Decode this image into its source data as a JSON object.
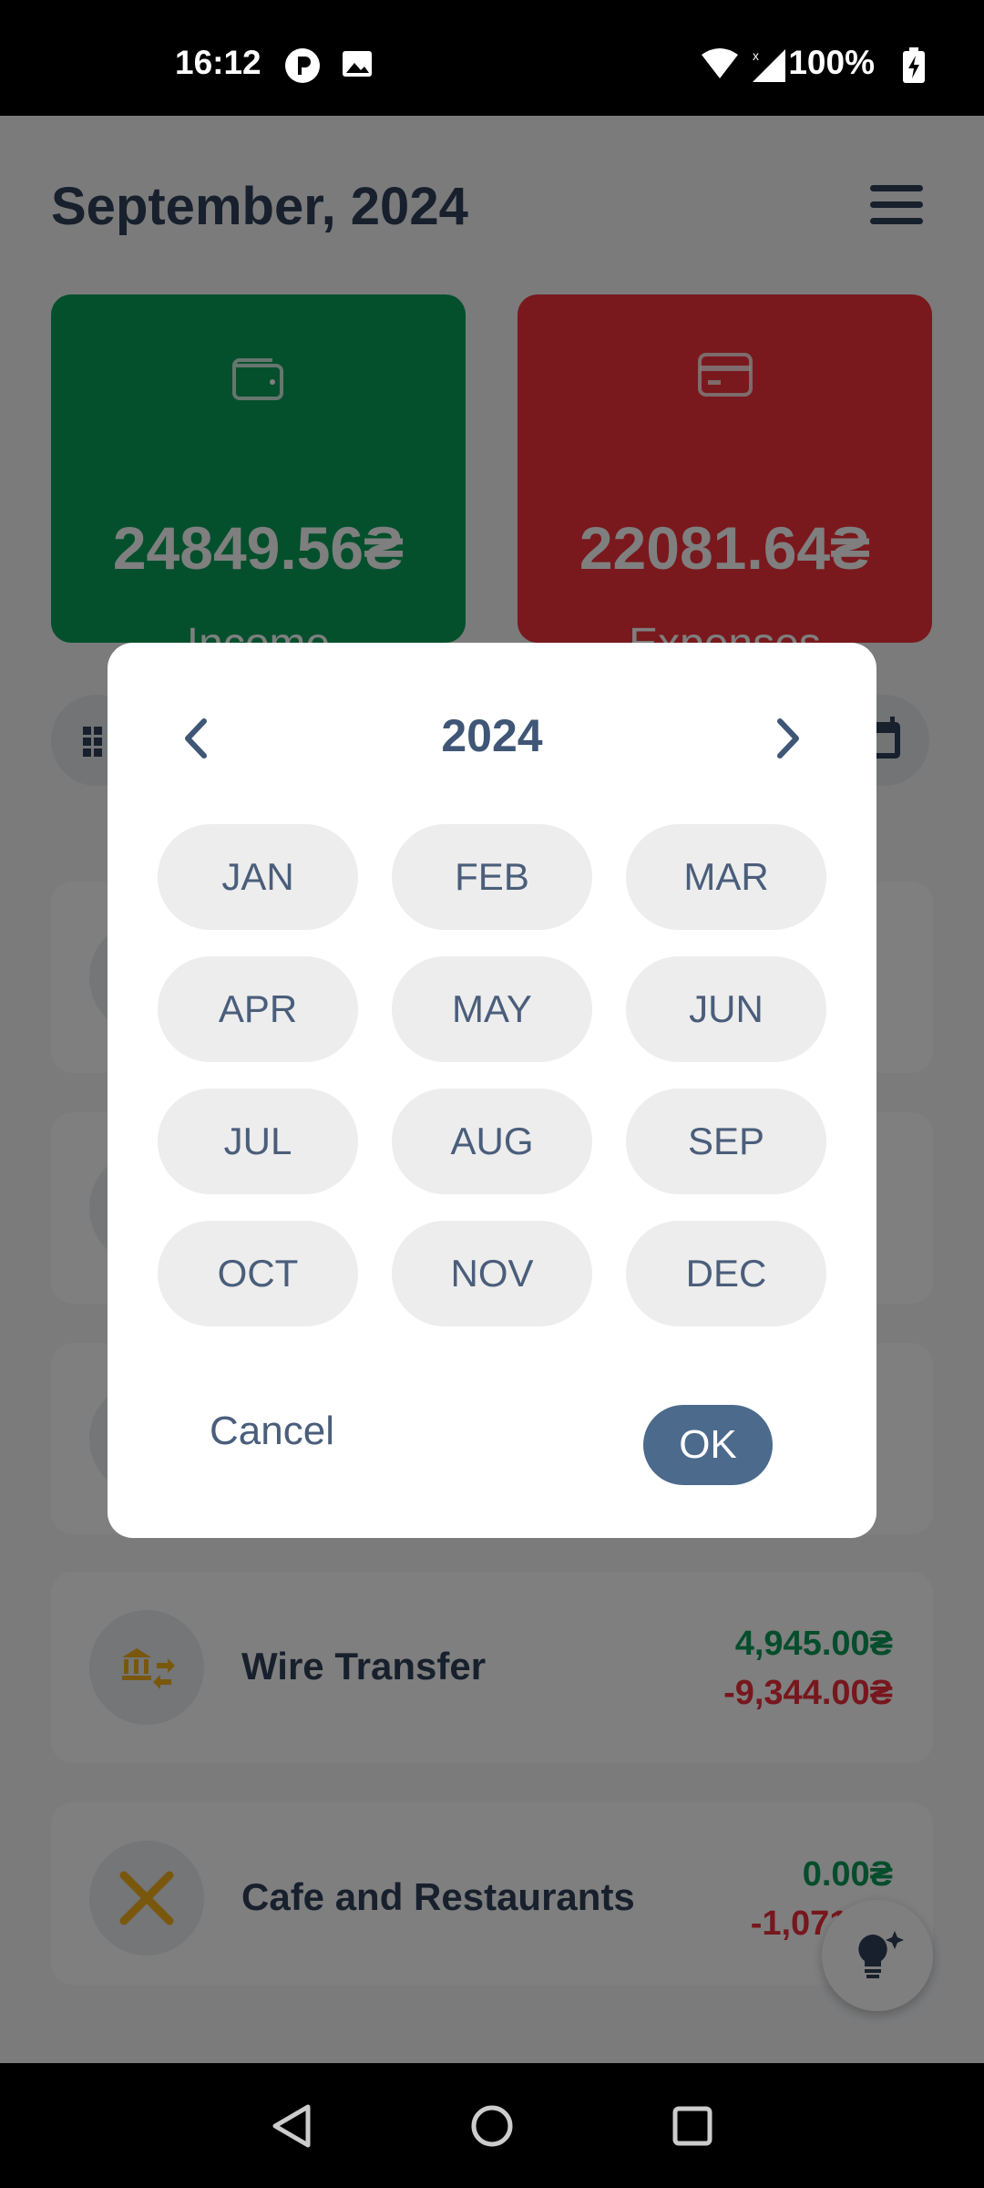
{
  "status_bar": {
    "time": "16:12",
    "battery": "100%"
  },
  "header": {
    "title": "September, 2024"
  },
  "summary": {
    "income_label": "Income",
    "income_amount": "24849.56₴",
    "expenses_label": "Expenses",
    "expenses_amount": "22081.64₴"
  },
  "categories": [
    {
      "name": "",
      "income": "",
      "expense": ""
    },
    {
      "name": "",
      "income": "",
      "expense": ""
    },
    {
      "name": "",
      "income": "",
      "expense": ""
    },
    {
      "name": "Wire Transfer",
      "income": "4,945.00₴",
      "expense": "-9,344.00₴"
    },
    {
      "name": "Cafe and Restaurants",
      "income": "0.00₴",
      "expense": "-1,071.…"
    }
  ],
  "dialog": {
    "year": "2024",
    "months": [
      "JAN",
      "FEB",
      "MAR",
      "APR",
      "MAY",
      "JUN",
      "JUL",
      "AUG",
      "SEP",
      "OCT",
      "NOV",
      "DEC"
    ],
    "cancel_label": "Cancel",
    "ok_label": "OK"
  },
  "colors": {
    "income_green": "#08a05b",
    "expense_red": "#f2323a",
    "primary_text": "#2f4159",
    "ok_button": "#4c6a8c"
  }
}
